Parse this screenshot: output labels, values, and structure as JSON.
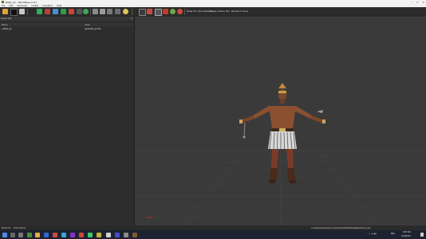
{
  "window": {
    "title": "Billet_pk - MeshBase 2.8.1"
  },
  "menu": [
    "File",
    "Edit",
    "Geometry",
    "Create",
    "Animation",
    "Help"
  ],
  "toolbar": {
    "items": [
      "Model Info",
      "Show Skeleton",
      "Display",
      "Texture",
      "Rim",
      "Normals on Faces"
    ]
  },
  "panel": {
    "title": "Scene List",
    "close": "✕",
    "columns": {
      "name": "Name",
      "value": "Value"
    },
    "row": {
      "name": "▸ Billet_pk",
      "value": "geo/billet_pk.fbx"
    }
  },
  "statusbar": {
    "left": "Model Info",
    "middle": "2079 Vertices",
    "path": "C:/Users/Alexander/Documents/Models/Billet/MeshBase/billet_pk.fbx"
  },
  "taskbar": {
    "time": "9:03 AM",
    "date": "7/19/2021",
    "lang": "ENG"
  },
  "colors": {
    "accent": "#3c7fd1",
    "background": "#3a3a3a"
  }
}
